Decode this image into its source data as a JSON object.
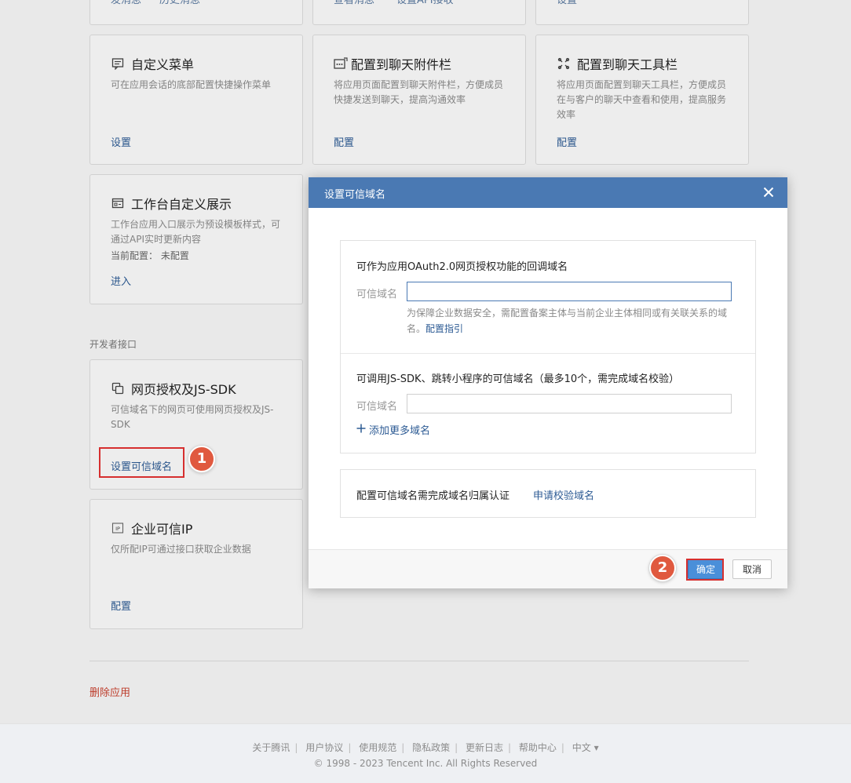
{
  "top_partial": {
    "col1_a": "发消息",
    "col1_b": "历史消息",
    "col2_a": "查看消息",
    "col2_b": "设置API接收",
    "col3_a": "设置"
  },
  "cards": {
    "custom_menu": {
      "title": "自定义菜单",
      "desc": "可在应用会话的底部配置快捷操作菜单",
      "link": "设置",
      "icon": "menu-icon"
    },
    "chat_attach": {
      "title": "配置到聊天附件栏",
      "desc": "将应用页面配置到聊天附件栏，方便成员快捷发送到聊天，提高沟通效率",
      "link": "配置",
      "icon": "attachment-grid-icon"
    },
    "chat_toolbar": {
      "title": "配置到聊天工具栏",
      "desc": "将应用页面配置到聊天工具栏，方便成员在与客户的聊天中查看和使用，提高服务效率",
      "link": "配置",
      "icon": "toolbar-icon"
    },
    "workbench": {
      "title": "工作台自定义展示",
      "desc": "工作台应用入口展示为预设模板样式，可通过API实时更新内容",
      "current_label": "当前配置：",
      "current_value": "未配置",
      "link": "进入",
      "icon": "workbench-icon"
    },
    "web_auth": {
      "title": "网页授权及JS-SDK",
      "desc": "可信域名下的网页可使用网页授权及JS-SDK",
      "link": "设置可信域名",
      "icon": "copy-icon"
    },
    "trusted_ip": {
      "title": "企业可信IP",
      "desc": "仅所配IP可通过接口获取企业数据",
      "link": "配置",
      "icon": "ip-icon"
    }
  },
  "section_label": "开发者接口",
  "delete_app": "删除应用",
  "footer": {
    "links": [
      "关于腾讯",
      "用户协议",
      "使用规范",
      "隐私政策",
      "更新日志",
      "帮助中心",
      "中文 ▾"
    ],
    "copyright": "© 1998 - 2023 Tencent Inc. All Rights Reserved"
  },
  "modal": {
    "title": "设置可信域名",
    "oauth": {
      "title": "可作为应用OAuth2.0网页授权功能的回调域名",
      "label": "可信域名",
      "value": "",
      "hint": "为保障企业数据安全，需配置备案主体与当前企业主体相同或有关联关系的域名。",
      "hint_link": "配置指引"
    },
    "jssdk": {
      "title": "可调用JS-SDK、跳转小程序的可信域名（最多10个，需完成域名校验）",
      "label": "可信域名",
      "value": "",
      "add_more": "添加更多域名"
    },
    "verify": {
      "text": "配置可信域名需完成域名归属认证",
      "link": "申请校验域名"
    },
    "ok_label": "确定",
    "cancel_label": "取消"
  },
  "annotations": {
    "step1": "1",
    "step2": "2"
  }
}
